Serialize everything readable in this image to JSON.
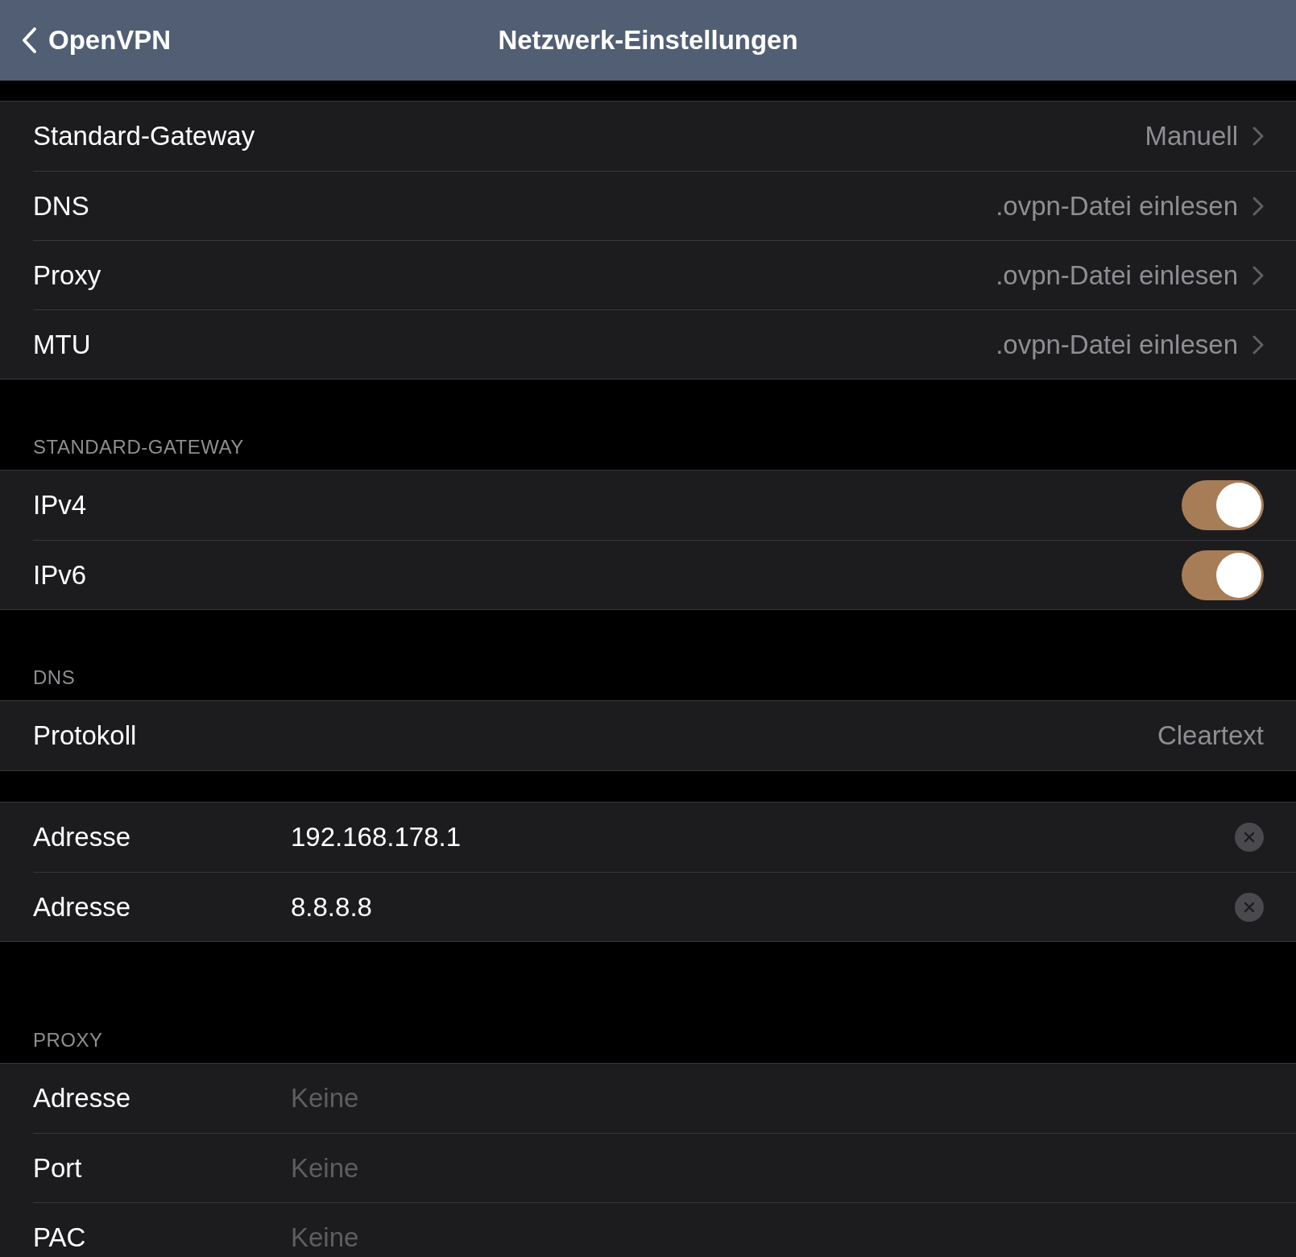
{
  "nav": {
    "back": "OpenVPN",
    "title": "Netzwerk-Einstellungen"
  },
  "sections": [
    {
      "rows": [
        {
          "kind": "link",
          "label": "Standard-Gateway",
          "value": "Manuell"
        },
        {
          "kind": "link",
          "label": "DNS",
          "value": ".ovpn-Datei einlesen"
        },
        {
          "kind": "link",
          "label": "Proxy",
          "value": ".ovpn-Datei einlesen"
        },
        {
          "kind": "link",
          "label": "MTU",
          "value": ".ovpn-Datei einlesen"
        }
      ]
    },
    {
      "header": "STANDARD-GATEWAY",
      "rows": [
        {
          "kind": "toggle",
          "label": "IPv4",
          "on": true
        },
        {
          "kind": "toggle",
          "label": "IPv6",
          "on": true
        }
      ]
    },
    {
      "header": "DNS",
      "rows": [
        {
          "kind": "value",
          "label": "Protokoll",
          "value": "Cleartext"
        }
      ]
    },
    {
      "rows": [
        {
          "kind": "field",
          "label": "Adresse",
          "value": "192.168.178.1",
          "clearable": true
        },
        {
          "kind": "field",
          "label": "Adresse",
          "value": "8.8.8.8",
          "clearable": true
        }
      ]
    },
    {
      "header": "PROXY",
      "rows": [
        {
          "kind": "field",
          "label": "Adresse",
          "placeholder": "Keine"
        },
        {
          "kind": "field",
          "label": "Port",
          "placeholder": "Keine"
        },
        {
          "kind": "field",
          "label": "PAC",
          "placeholder": "Keine"
        }
      ]
    }
  ]
}
